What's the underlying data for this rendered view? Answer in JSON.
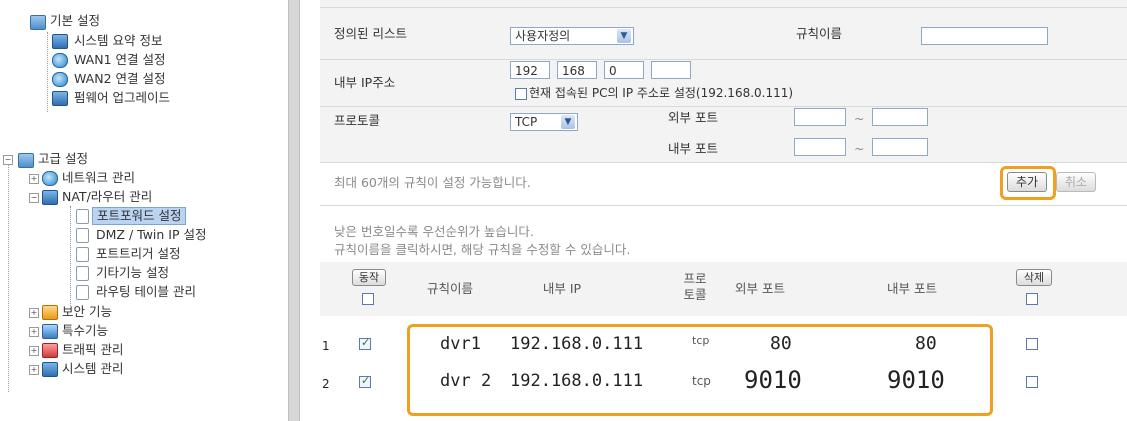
{
  "sidebar": {
    "basic": {
      "label": "기본 설정",
      "items": [
        "시스템 요약 정보",
        "WAN1 연결 설정",
        "WAN2 연결 설정",
        "펌웨어 업그레이드"
      ]
    },
    "advanced": {
      "label": "고급 설정",
      "network": "네트워크 관리",
      "nat": "NAT/라우터 관리",
      "nat_items": [
        "포트포워드 설정",
        "DMZ / Twin IP 설정",
        "포트트리거 설정",
        "기타기능 설정",
        "라우팅 테이블 관리"
      ],
      "rest": [
        "보안 기능",
        "특수기능",
        "트래픽 관리",
        "시스템 관리"
      ]
    }
  },
  "form": {
    "defined_list_label": "정의된 리스트",
    "defined_list_value": "사용자정의",
    "rule_name_label": "규칙이름",
    "rule_name_value": "",
    "internal_ip_label": "내부 IP주소",
    "ip": [
      "192",
      "168",
      "0",
      ""
    ],
    "current_pc_label": "현재 접속된 PC의 IP 주소로 설정(192.168.0.111)",
    "protocol_label": "프로토콜",
    "protocol_value": "TCP",
    "external_port_label": "외부 포트",
    "internal_port_label": "내부 포트",
    "port_sep": "~",
    "max_rules_note": "최대 60개의 규칙이 설정 가능합니다.",
    "add_button": "추가",
    "cancel_button": "취소",
    "note1": "낮은 번호일수록 우선순위가 높습니다.",
    "note2": "규칙이름을 클릭하시면, 해당 규칙을 수정할 수 있습니다."
  },
  "table": {
    "headers": {
      "operate": "동작",
      "name": "규칙이름",
      "ip": "내부 IP",
      "proto_line1": "프로",
      "proto_line2": "토콜",
      "ext": "외부 포트",
      "int": "내부 포트",
      "delete": "삭제"
    },
    "rows": [
      {
        "no": "1",
        "name": "dvr1",
        "ip": "192.168.0.111",
        "proto": "tcp",
        "ext": "80",
        "int": "80"
      },
      {
        "no": "2",
        "name": "dvr 2",
        "ip": "192.168.0.111",
        "proto": "tcp",
        "ext": "9010",
        "int": "9010"
      }
    ]
  },
  "colors": {
    "highlight": "#f0a020",
    "selection": "#b9d3f0",
    "row_background": "#f3f3f3"
  }
}
